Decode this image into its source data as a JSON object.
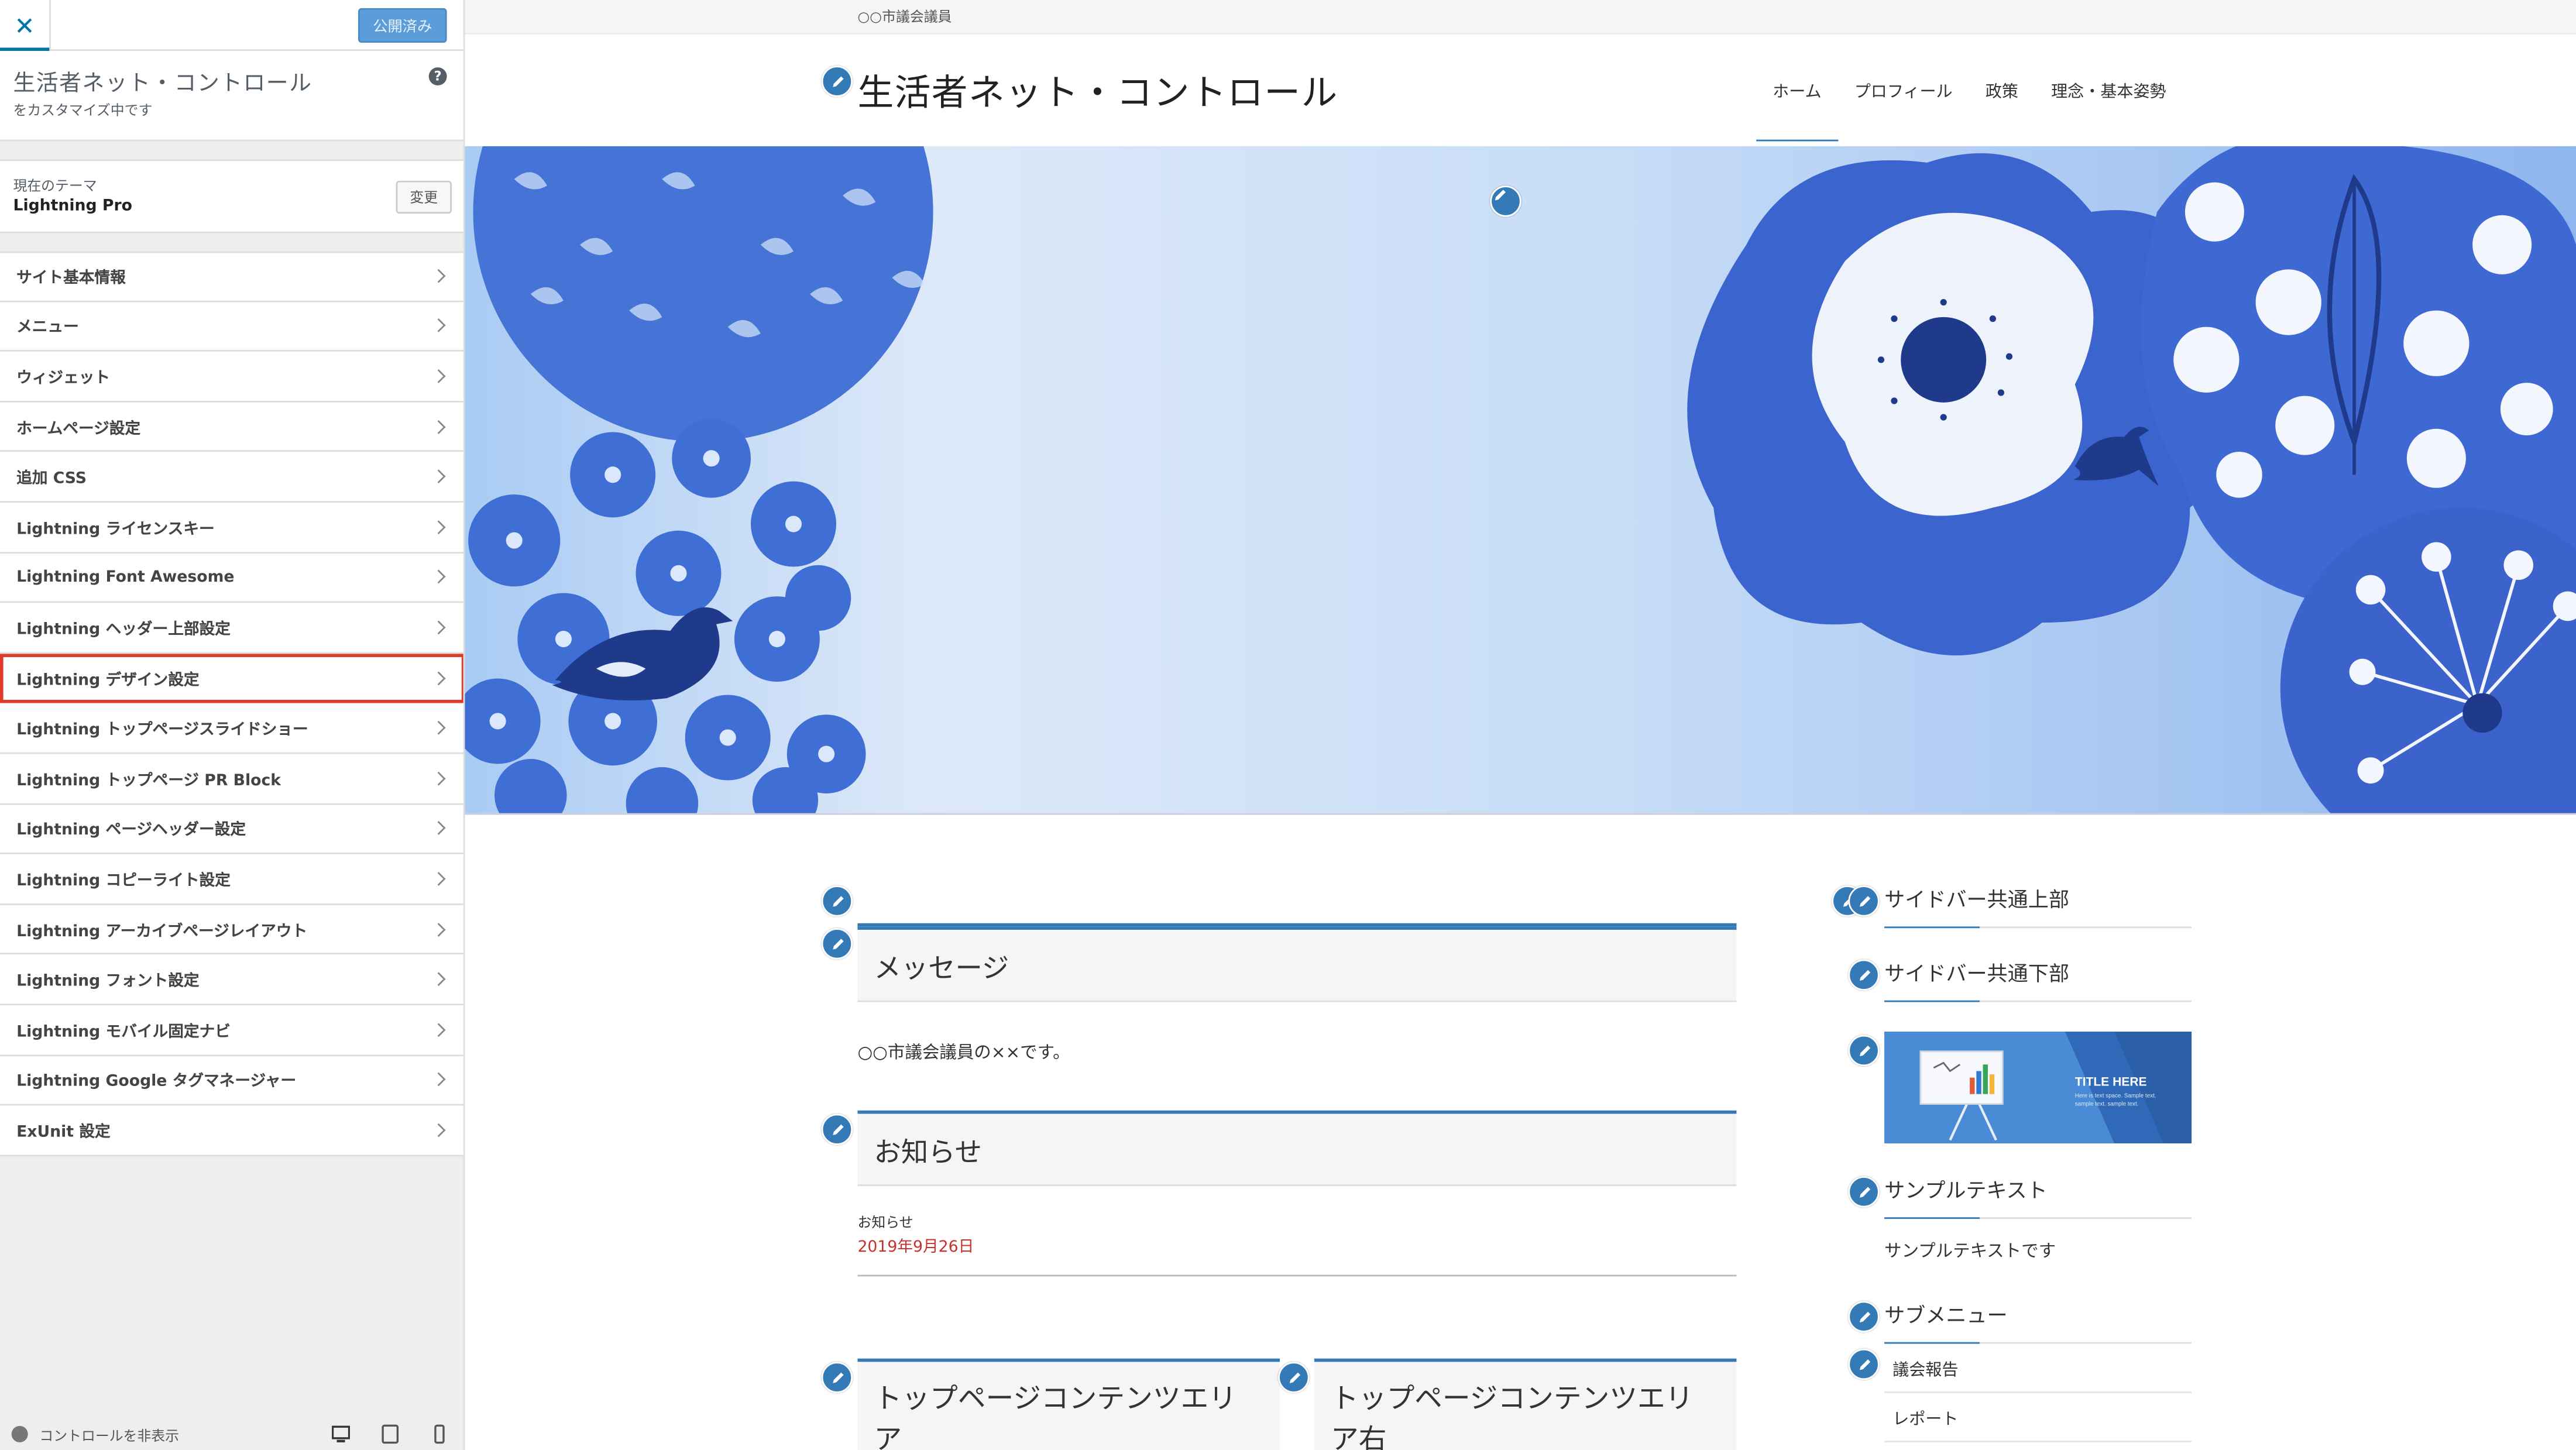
{
  "customizer": {
    "close_icon": "close-icon",
    "publish_label": "公開済み",
    "site_title": "生活者ネット・コントロール",
    "customizing_note": "をカスタマイズ中です",
    "help_icon": "?",
    "theme_label": "現在のテーマ",
    "theme_name": "Lightning Pro",
    "change_label": "変更",
    "sections": [
      "サイト基本情報",
      "メニュー",
      "ウィジェット",
      "ホームページ設定",
      "追加 CSS",
      "Lightning ライセンスキー",
      "Lightning Font Awesome",
      "Lightning ヘッダー上部設定",
      "Lightning デザイン設定",
      "Lightning トップページスライドショー",
      "Lightning トップページ PR Block",
      "Lightning ページヘッダー設定",
      "Lightning コピーライト設定",
      "Lightning アーカイブページレイアウト",
      "Lightning フォント設定",
      "Lightning モバイル固定ナビ",
      "Lightning Google タグマネージャー",
      "ExUnit 設定"
    ],
    "highlighted_section": "Lightning デザイン設定",
    "hide_controls_label": "コントロールを非表示"
  },
  "preview": {
    "site_description": "○○市議会議員",
    "logo_text": "生活者ネット・コントロール",
    "nav": [
      "ホーム",
      "プロフィール",
      "政策",
      "理念・基本姿勢"
    ],
    "active_nav": "ホーム",
    "main": {
      "message_heading": "メッセージ",
      "message_text": "○○市議会議員の××です。",
      "news_heading": "お知らせ",
      "news_category": "お知らせ",
      "news_date": "2019年9月26日",
      "content_left_heading_1": "トップページコンテンツエリ",
      "content_left_heading_2": "ア",
      "content_right_heading_1": "トップページコンテンツエリ",
      "content_right_heading_2": "ア右"
    },
    "sidebar": {
      "top_title": "サイドバー共通上部",
      "bottom_title": "サイドバー共通下部",
      "banner_text": "TITLE HERE",
      "banner_small_text": "Here is text space. Sample text. sample text. sample text.",
      "sample_title": "サンプルテキスト",
      "sample_text": "サンプルテキストです",
      "submenu_title": "サブメニュー",
      "submenu_items": [
        "議会報告",
        "レポート"
      ]
    }
  },
  "colors": {
    "accent": "#337ab7",
    "wp_blue": "#0073aa",
    "highlight_red": "#e03a2a",
    "date_red": "#c9302c"
  }
}
